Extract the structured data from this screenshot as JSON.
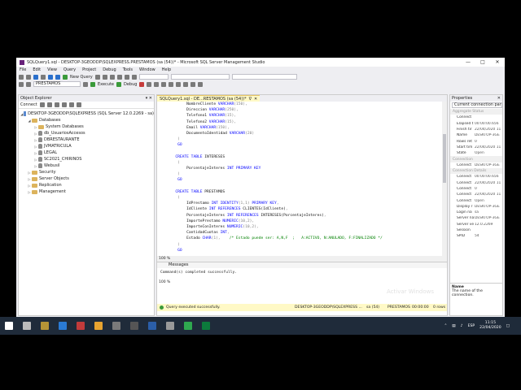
{
  "window": {
    "title": "SQLQuery1.sql - DESKTOP-3GEODDP\\SQLEXPRESS.PRESTAMOS (sa (54))* - Microsoft SQL Server Management Studio"
  },
  "menu": [
    "File",
    "Edit",
    "View",
    "Query",
    "Project",
    "Debug",
    "Tools",
    "Window",
    "Help"
  ],
  "toolbar": {
    "new_query": "New Query",
    "database": "PRESTAMOS",
    "execute": "Execute",
    "debug": "Debug"
  },
  "object_explorer": {
    "title": "Object Explorer",
    "connect": "Connect",
    "tree": [
      {
        "label": "DESKTOP-3GEODDP\\SQLEXPRESS (SQL Server 12.0.2269 - sa)",
        "level": 0,
        "icon": "server-icon",
        "expanded": true
      },
      {
        "label": "Databases",
        "level": 1,
        "icon": "folder-icon",
        "expanded": true
      },
      {
        "label": "System Databases",
        "level": 2,
        "icon": "folder-icon",
        "expanded": false
      },
      {
        "label": "db_UsuariosAccesos",
        "level": 2,
        "icon": "database-icon",
        "expanded": false
      },
      {
        "label": "DBRESTAURANTE",
        "level": 2,
        "icon": "database-icon",
        "expanded": false
      },
      {
        "label": "JVMATRICULA",
        "level": 2,
        "icon": "database-icon",
        "expanded": false
      },
      {
        "label": "LEGAL",
        "level": 2,
        "icon": "database-icon",
        "expanded": false
      },
      {
        "label": "SC2021_CHIRINOS",
        "level": 2,
        "icon": "database-icon",
        "expanded": false
      },
      {
        "label": "Webusil",
        "level": 2,
        "icon": "database-icon",
        "expanded": false
      },
      {
        "label": "Security",
        "level": 1,
        "icon": "folder-icon",
        "expanded": false
      },
      {
        "label": "Server Objects",
        "level": 1,
        "icon": "folder-icon",
        "expanded": false
      },
      {
        "label": "Replication",
        "level": 1,
        "icon": "folder-icon",
        "expanded": false
      },
      {
        "label": "Management",
        "level": 1,
        "icon": "folder-icon",
        "expanded": false
      }
    ]
  },
  "editor": {
    "tab_label": "SQLQuery1.sql - DE...RESTAMOS (sa (54))*",
    "lines": [
      [
        {
          "t": "        NombreCliente ",
          "c": "tx"
        },
        {
          "t": "VARCHAR",
          "c": "kw"
        },
        {
          "t": "(150)",
          "c": "gr"
        },
        {
          "t": ",",
          "c": "gr"
        }
      ],
      [
        {
          "t": "        Direccion ",
          "c": "tx"
        },
        {
          "t": "VARCHAR",
          "c": "kw"
        },
        {
          "t": "(250)",
          "c": "gr"
        },
        {
          "t": ",",
          "c": "gr"
        }
      ],
      [
        {
          "t": "        Telefono1 ",
          "c": "tx"
        },
        {
          "t": "VARCHAR",
          "c": "kw"
        },
        {
          "t": "(15)",
          "c": "gr"
        },
        {
          "t": ",",
          "c": "gr"
        }
      ],
      [
        {
          "t": "        Telefono2 ",
          "c": "tx"
        },
        {
          "t": "VARCHAR",
          "c": "kw"
        },
        {
          "t": "(15)",
          "c": "gr"
        },
        {
          "t": ",",
          "c": "gr"
        }
      ],
      [
        {
          "t": "        Email ",
          "c": "tx"
        },
        {
          "t": "VARCHAR",
          "c": "kw"
        },
        {
          "t": "(150)",
          "c": "gr"
        },
        {
          "t": ",",
          "c": "gr"
        }
      ],
      [
        {
          "t": "        DocumentoIdentidad ",
          "c": "tx"
        },
        {
          "t": "VARCHAR",
          "c": "kw"
        },
        {
          "t": "(20)",
          "c": "gr"
        }
      ],
      [
        {
          "t": "    )",
          "c": "gr"
        }
      ],
      [
        {
          "t": "    GO",
          "c": "kw"
        }
      ],
      [
        {
          "t": "",
          "c": "tx"
        }
      ],
      [
        {
          "t": "   ",
          "c": "tx"
        },
        {
          "t": "CREATE TABLE",
          "c": "kw"
        },
        {
          "t": " INTERESES",
          "c": "tx"
        }
      ],
      [
        {
          "t": "    (",
          "c": "gr"
        }
      ],
      [
        {
          "t": "        PorcentajeInteres ",
          "c": "tx"
        },
        {
          "t": "INT PRIMARY KEY",
          "c": "kw"
        }
      ],
      [
        {
          "t": "    )",
          "c": "gr"
        }
      ],
      [
        {
          "t": "    GO",
          "c": "kw"
        }
      ],
      [
        {
          "t": "",
          "c": "tx"
        }
      ],
      [
        {
          "t": "   ",
          "c": "tx"
        },
        {
          "t": "CREATE TABLE",
          "c": "kw"
        },
        {
          "t": " PRESTAMOS",
          "c": "tx"
        }
      ],
      [
        {
          "t": "    (",
          "c": "gr"
        }
      ],
      [
        {
          "t": "        IdPrestamo ",
          "c": "tx"
        },
        {
          "t": "INT IDENTITY",
          "c": "kw"
        },
        {
          "t": "(1,1) ",
          "c": "gr"
        },
        {
          "t": "PRIMARY KEY",
          "c": "kw"
        },
        {
          "t": ",",
          "c": "gr"
        }
      ],
      [
        {
          "t": "        IdCliente ",
          "c": "tx"
        },
        {
          "t": "INT REFERENCES",
          "c": "kw"
        },
        {
          "t": " CLIENTES(IdCliente)",
          "c": "tx"
        },
        {
          "t": ",",
          "c": "gr"
        }
      ],
      [
        {
          "t": "        PorcentajeInteres ",
          "c": "tx"
        },
        {
          "t": "INT REFERENCES",
          "c": "kw"
        },
        {
          "t": " INTERESES(PorcentajeInteres)",
          "c": "tx"
        },
        {
          "t": ",",
          "c": "gr"
        }
      ],
      [
        {
          "t": "        ImportePrestamo ",
          "c": "tx"
        },
        {
          "t": "NUMERIC",
          "c": "kw"
        },
        {
          "t": "(10,2)",
          "c": "gr"
        },
        {
          "t": ",",
          "c": "gr"
        }
      ],
      [
        {
          "t": "        ImporteConInteres ",
          "c": "tx"
        },
        {
          "t": "NUMERIC",
          "c": "kw"
        },
        {
          "t": "(10,2)",
          "c": "gr"
        },
        {
          "t": ",",
          "c": "gr"
        }
      ],
      [
        {
          "t": "        CantidadCuotas ",
          "c": "tx"
        },
        {
          "t": "INT",
          "c": "kw"
        },
        {
          "t": ",",
          "c": "gr"
        }
      ],
      [
        {
          "t": "        Estado ",
          "c": "tx"
        },
        {
          "t": "CHAR",
          "c": "kw"
        },
        {
          "t": "(1)",
          "c": "gr"
        },
        {
          "t": ",    ",
          "c": "gr"
        },
        {
          "t": "/* Estado puede ser: A,N,F  ;   A:ACTIVO, N:ANULADO, F:FINALIZADO */",
          "c": "cm"
        }
      ],
      [
        {
          "t": "    )",
          "c": "gr"
        }
      ],
      [
        {
          "t": "    GO",
          "c": "kw"
        }
      ]
    ],
    "zoom": "100 %",
    "messages_tab": "Messages",
    "message": "Command(s) completed successfully.",
    "results_zoom": "100 %",
    "status": {
      "text": "Query executed successfully.",
      "server": "DESKTOP-3GEODDP\\SQLEXPRESS ...",
      "user": "sa (54)",
      "db": "PRESTAMOS",
      "time": "00:00:00",
      "rows": "0 rows"
    }
  },
  "properties": {
    "title": "Properties",
    "dropdown": "Current connection par",
    "rows": [
      {
        "k": "Aggregate Status",
        "v": "",
        "cat": true
      },
      {
        "k": "Connect",
        "v": ""
      },
      {
        "k": "Elapsed t",
        "v": "00:00:00.656"
      },
      {
        "k": "Finish tir",
        "v": "22/04/2020 11"
      },
      {
        "k": "Name",
        "v": "DESKTOP-3GE"
      },
      {
        "k": "Rows ret",
        "v": "0"
      },
      {
        "k": "Start tim",
        "v": "22/04/2020 11"
      },
      {
        "k": "State",
        "v": "Open"
      },
      {
        "k": "Connection",
        "v": "",
        "cat": true
      },
      {
        "k": "Connect",
        "v": "DESKTOP-3GE"
      },
      {
        "k": "Connection Details",
        "v": "",
        "cat": true
      },
      {
        "k": "Connect",
        "v": "00:00:00.656"
      },
      {
        "k": "Connect",
        "v": "22/04/2020 11"
      },
      {
        "k": "Connect",
        "v": "0"
      },
      {
        "k": "Connect",
        "v": "22/04/2020 11"
      },
      {
        "k": "Connect",
        "v": "Open"
      },
      {
        "k": "Display r",
        "v": "DESKTOP-3GE"
      },
      {
        "k": "Login na",
        "v": "sa"
      },
      {
        "k": "Server na",
        "v": "DESKTOP-3GE"
      },
      {
        "k": "Server ve",
        "v": "12.0.2269"
      },
      {
        "k": "Session",
        "v": ""
      },
      {
        "k": "SPID",
        "v": "54"
      }
    ],
    "desc_title": "Name",
    "desc_text": "The name of the connection."
  },
  "statusbar": {
    "left": "Matches (",
    "ln": "Ln 41",
    "col": "Col 88",
    "ch": "Ch 85",
    "ins": "INS"
  },
  "watermark": "Activar Windows",
  "taskbar": {
    "lang": "ESP",
    "time": "11:15",
    "date": "22/04/2020"
  }
}
